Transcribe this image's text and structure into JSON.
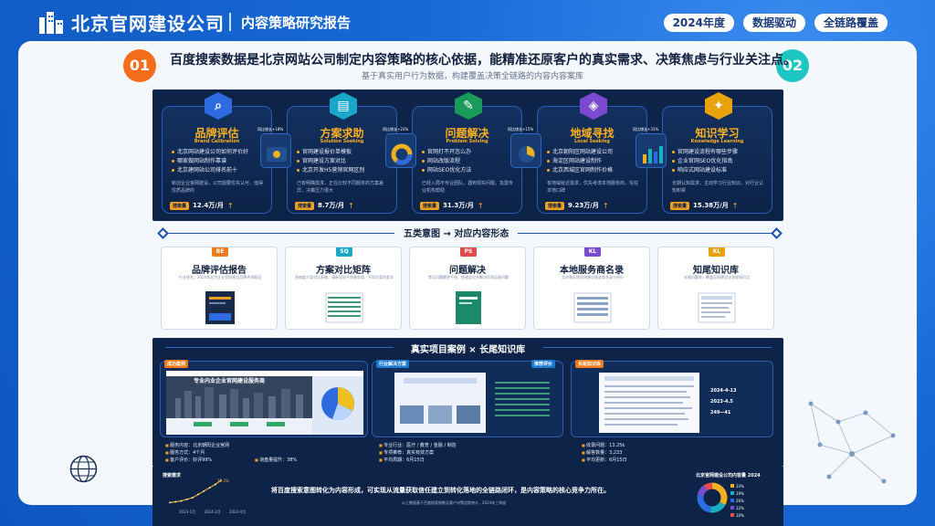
{
  "header": {
    "brand": "北京官网建设公司",
    "subtitle": "内容策略研究报告",
    "tags": [
      "2024年度",
      "数据驱动",
      "全链路覆盖"
    ]
  },
  "headline": {
    "badge_left": "01",
    "badge_right": "02",
    "text": "百度搜索数据是北京网站公司制定内容策略的核心依据，能精准还原客户的真实需求、决策焦虑与行业关注点。",
    "sub": "基于真实用户行为数据，构建覆盖决策全链路的内容内容案库"
  },
  "intents": [
    {
      "icon": "magnifier-icon",
      "title": "品牌评估",
      "en": "Brand Calibration",
      "color": "#2f6be0",
      "items": [
        "北京网站建设公司如何评价好",
        "哪家做网站制作靠谱",
        "北京建网站公司排名前十"
      ],
      "desc": "新创企业官网建设，公司需要优先认可，值得优质品牌的",
      "vol_label": "搜索量",
      "vol": "12.4万/月"
    },
    {
      "icon": "document-icon",
      "title": "方案求助",
      "en": "Solution Seeking",
      "color": "#1aa6c8",
      "items": [
        "官网建设报价单模板",
        "官网建设方案对比",
        "北京开发H5营销官网区别"
      ],
      "desc": "已有明确需求，正在比较不同服务的方案差异，决策压力很大",
      "vol_label": "搜索量",
      "vol": "8.7万/月"
    },
    {
      "icon": "wrench-icon",
      "title": "问题解决",
      "en": "Problem Solving",
      "color": "#1a9a5a",
      "items": [
        "官网打不开怎么办",
        "网站改版流程",
        "网站SEO优化方法"
      ],
      "desc": "已经入局不专业团队，遇到现实问题，急需专业机构帮助",
      "vol_label": "搜索量",
      "vol": "31.3万/月"
    },
    {
      "icon": "location-icon",
      "title": "地域寻找",
      "en": "Local Seeking",
      "color": "#7a4ad0",
      "items": [
        "北京朝阳区网站建设公司",
        "海淀区网站建设制作",
        "北京西城区官网制作价格"
      ],
      "desc": "有地域就近需求，优先考虑本地服务商，信任本地口碑",
      "vol_label": "搜索量",
      "vol": "9.23万/月"
    },
    {
      "icon": "lightbulb-icon",
      "title": "知识学习",
      "en": "Knowledge Learning",
      "color": "#e8a20a",
      "items": [
        "官网建设流程有哪些步骤",
        "企业官网SEO优化指南",
        "响应式网站建设标准"
      ],
      "desc": "长期认知需求，主动学习行业知识，对行业认知积累",
      "vol_label": "搜索量",
      "vol": "15.38万/月"
    }
  ],
  "mini_labels": [
    "同比增长+18%",
    "同比增长+23%",
    "同比增长+15%",
    "同比增长+31%"
  ],
  "section2": {
    "title": "五类意图 → 对应内容形态",
    "cards": [
      {
        "badge": "BE",
        "color": "#f07a1a",
        "title": "品牌评估报告",
        "desc": "行业排名、2024年北京企业官网建设品牌评测报告"
      },
      {
        "badge": "SQ",
        "color": "#1aa6c8",
        "title": "方案对比矩阵",
        "desc": "多维度方案对比表格，清晰呈现不同服务商、不同方案的差异"
      },
      {
        "badge": "PS",
        "color": "#e04a4a",
        "title": "问题解决",
        "desc": "常见问题解答手册，快速定位并解决官网运维问题"
      },
      {
        "badge": "KL",
        "color": "#7a4ad0",
        "title": "本地服务商名录",
        "desc": "北京各区域官网建设服务商名录与评价"
      },
      {
        "badge": "KL",
        "color": "#e8a20a",
        "title": "知尾知识库",
        "desc": "长尾问题库，覆盖官网建设全流程知识点"
      }
    ]
  },
  "section3": {
    "title": "真实项目案例 × 长尾知识库",
    "cases": [
      {
        "tag": "成功案例",
        "screen_title": "专业内业企业官网建设服务商",
        "stats": [
          "服务内容：北京朝阳企业官网",
          "服务方式：4个月",
          "客户评价：好评99%"
        ],
        "stats2": [
          "询盘量提升：38%"
        ]
      },
      {
        "tag": "行业解决方案",
        "tag2": "推荐评价",
        "stats": [
          "专业行业：医疗 / 教育 / 金融 / 制造",
          "专项推荐：真实有效方案",
          "平均周期：6月15日"
        ]
      },
      {
        "tag": "长尾知识库",
        "stats": [
          "收录问题：13.25k",
          "解答数量：3,233",
          "平均更新：6月15日"
        ],
        "side": [
          "2024-4-13",
          "2023-4.5",
          "249—41"
        ]
      }
    ]
  },
  "footer": {
    "main": "将百度搜索意图转化为内容形成，可实现从流量获取信任建立到转化落地的全链路闭环，是内容策略的核心竞争力所在。",
    "sub": "以上数据基于百度搜索指数及客户决策追踪统计，2024年三季度"
  },
  "trend": {
    "label": "搜索需求",
    "start": "2023-1月",
    "end": "2024-4月",
    "mid_label": "2024-2月",
    "peak": "31.3%",
    "values": [
      4,
      5,
      6,
      8,
      10,
      14,
      18,
      22,
      26,
      31
    ]
  },
  "donut": {
    "label": "北京官网建设公司内容量 2024",
    "legend": [
      "33%",
      "19%",
      "26%",
      "12%",
      "10%"
    ],
    "values": [
      33,
      19,
      26,
      12,
      10
    ],
    "colors": [
      "#f0b020",
      "#1ab0c0",
      "#2f6be0",
      "#7a4ad0",
      "#e84a4a"
    ]
  }
}
